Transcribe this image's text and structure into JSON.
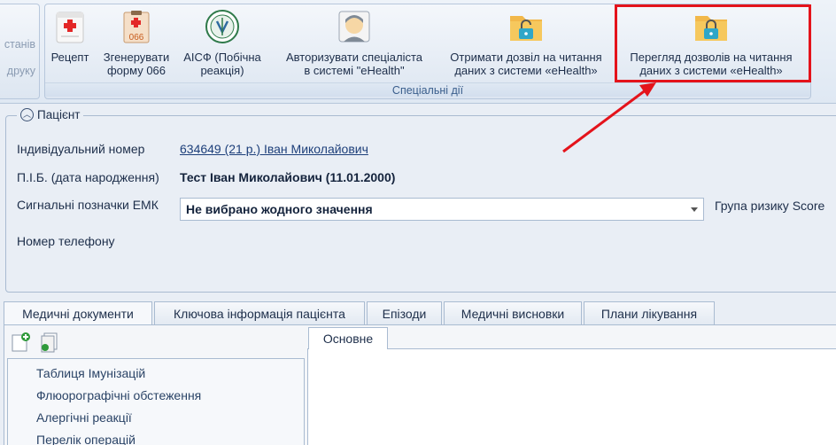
{
  "ribbon": {
    "left_group_partial": [
      "станів",
      "друку"
    ],
    "group_label": "Спеціальні дії",
    "buttons": [
      {
        "label1": "Рецепт",
        "label2": "",
        "icon": "prescription-icon"
      },
      {
        "label1": "Згенерувати",
        "label2": "форму 066",
        "icon": "form-066-icon"
      },
      {
        "label1": "АІСФ (Побічна",
        "label2": "реакція)",
        "icon": "aisf-emblem-icon"
      },
      {
        "label1": "Авторизувати спеціаліста",
        "label2": "в системі \"eHealth\"",
        "icon": "doctor-avatar-icon"
      },
      {
        "label1": "Отримати дозвіл на читання",
        "label2": "даних з системи «eHealth»",
        "icon": "folder-unlock-icon"
      },
      {
        "label1": "Перегляд дозволів на читання",
        "label2": "даних з системи «eHealth»",
        "icon": "folder-lock-icon"
      }
    ],
    "form_icon_text": "066"
  },
  "patient": {
    "title": "Пацієнт",
    "id_label": "Індивідуальний номер",
    "id_value": "634649 (21 р.) Іван Миколайович",
    "name_label": "П.І.Б. (дата народження)",
    "name_value": "Тест Іван Миколайович (11.01.2000)",
    "emk_label": "Сигнальні позначки ЕМК",
    "emk_value": "Не вибрано жодного значення",
    "risk_label": "Група ризику Score",
    "phone_label": "Номер телефону"
  },
  "tabs": [
    "Медичні документи",
    "Ключова інформація пацієнта",
    "Епізоди",
    "Медичні висновки",
    "Плани лікування"
  ],
  "tree_items": [
    "Таблиця Імунізацій",
    "Флюорографічні обстеження",
    "Алергічні реакції",
    "Перелік операцій"
  ],
  "inner_tab": "Основне",
  "colors": {
    "highlight": "#e4131b",
    "accent": "#3a5e8c"
  }
}
